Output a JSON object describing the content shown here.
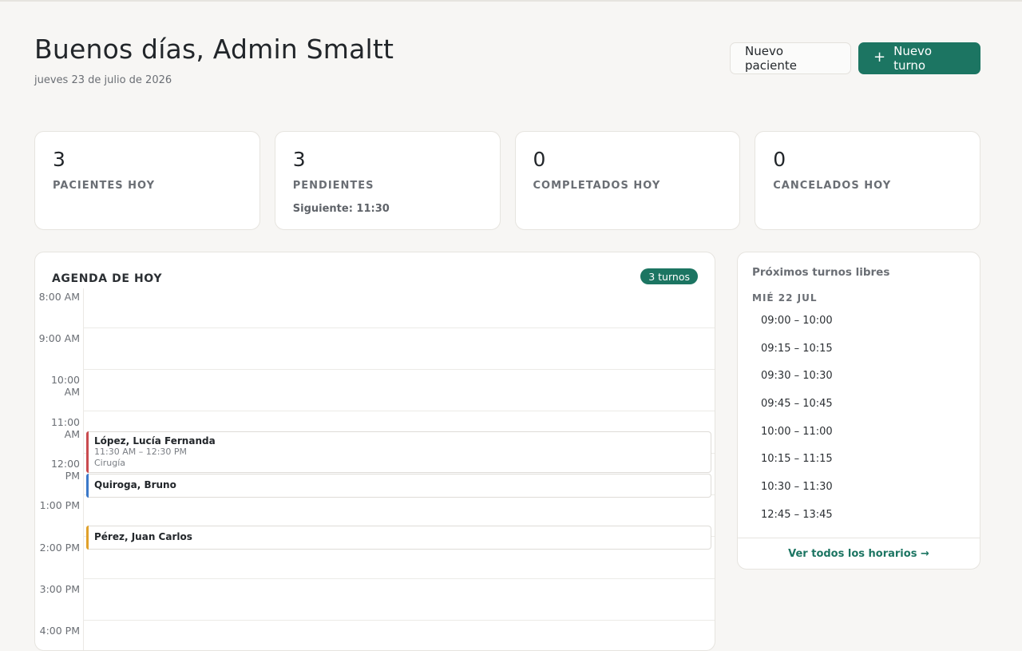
{
  "header": {
    "greeting": "Buenos días, Admin Smaltt",
    "date": "jueves 23 de julio de 2026",
    "new_patient_label": "Nuevo paciente",
    "new_appointment_icon": "plus-icon",
    "new_appointment_label": "Nuevo turno"
  },
  "stats": [
    {
      "value": "3",
      "label": "PACIENTES HOY",
      "sub": ""
    },
    {
      "value": "3",
      "label": "PENDIENTES",
      "sub": "Siguiente: 11:30"
    },
    {
      "value": "0",
      "label": "COMPLETADOS HOY",
      "sub": ""
    },
    {
      "value": "0",
      "label": "CANCELADOS HOY",
      "sub": ""
    }
  ],
  "agenda": {
    "title": "AGENDA DE HOY",
    "badge": "3 turnos",
    "hours": [
      "8:00 AM",
      "9:00 AM",
      "10:00 AM",
      "11:00 AM",
      "12:00 PM",
      "1:00 PM",
      "2:00 PM",
      "3:00 PM",
      "4:00 PM"
    ],
    "events": [
      {
        "name": "López, Lucía Fernanda",
        "time": "11:30 AM – 12:30 PM",
        "type": "Cirugía",
        "color": "#c94b4f"
      },
      {
        "name": "Quiroga, Bruno",
        "time": "",
        "type": "",
        "color": "#3b78c9"
      },
      {
        "name": "Pérez, Juan Carlos",
        "time": "",
        "type": "",
        "color": "#e0a12b"
      }
    ]
  },
  "free_slots": {
    "title": "Próximos turnos libres",
    "day": "MIÉ 22 JUL",
    "slots": [
      "09:00 – 10:00",
      "09:15 – 10:15",
      "09:30 – 10:30",
      "09:45 – 10:45",
      "10:00 – 11:00",
      "10:15 – 11:15",
      "10:30 – 11:30",
      "12:45 – 13:45"
    ],
    "footer_link": "Ver todos los horarios →"
  },
  "colors": {
    "accent": "#1c7562",
    "background": "#f7f6f4"
  }
}
